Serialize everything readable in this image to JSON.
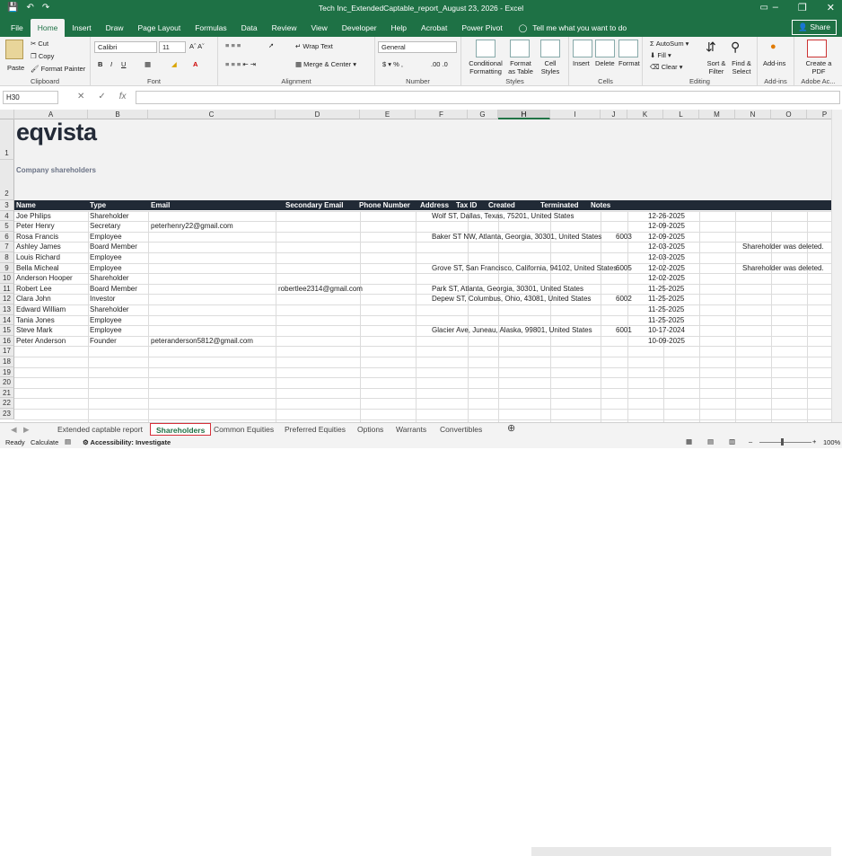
{
  "title_bar": {
    "title": "Tech Inc_ExtendedCaptable_report_August 23, 2026  -  Excel"
  },
  "ribbon_tabs": [
    "File",
    "Home",
    "Insert",
    "Draw",
    "Page Layout",
    "Formulas",
    "Data",
    "Review",
    "View",
    "Developer",
    "Help",
    "Acrobat",
    "Power Pivot"
  ],
  "tell_me": "Tell me what you want to do",
  "share_label": "Share",
  "ribbon": {
    "clipboard": {
      "paste": "Paste",
      "cut": "Cut",
      "copy": "Copy",
      "format_painter": "Format Painter",
      "label": "Clipboard"
    },
    "font": {
      "name": "Calibri",
      "size": "11",
      "label": "Font"
    },
    "alignment": {
      "wrap": "Wrap Text",
      "merge": "Merge & Center",
      "label": "Alignment"
    },
    "number": {
      "format": "General",
      "label": "Number"
    },
    "styles": {
      "conditional": "Conditional Formatting",
      "table": "Format as Table",
      "cell_styles": "Cell Styles",
      "label": "Styles"
    },
    "cells": {
      "insert": "Insert",
      "delete": "Delete",
      "format": "Format",
      "label": "Cells"
    },
    "editing": {
      "autosum": "AutoSum",
      "fill": "Fill",
      "clear": "Clear",
      "sort": "Sort & Filter",
      "find": "Find & Select",
      "label": "Editing"
    },
    "addins": {
      "addins": "Add-ins",
      "label": "Add-ins"
    },
    "adobe": {
      "create_pdf": "Create a PDF",
      "label": "Adobe Ac..."
    }
  },
  "formula_bar": {
    "name_box": "H30",
    "value": ""
  },
  "columns": [
    "A",
    "B",
    "C",
    "D",
    "E",
    "F",
    "G",
    "H",
    "I",
    "J",
    "K",
    "L",
    "M",
    "N",
    "O",
    "P"
  ],
  "rows": [
    "1",
    "2",
    "3",
    "4",
    "5",
    "6",
    "7",
    "8",
    "9",
    "10",
    "11",
    "12",
    "13",
    "14",
    "15",
    "16",
    "17",
    "18",
    "19",
    "20",
    "21",
    "22",
    "23"
  ],
  "sheet": {
    "logo": "eqvista",
    "subtitle": "Company shareholders",
    "headers": [
      "Name",
      "Type",
      "Email",
      "Secondary Email",
      "Phone Number",
      "Address",
      "Tax ID",
      "Created",
      "Terminated",
      "Notes"
    ],
    "data": [
      [
        "Joe Philips",
        "Shareholder",
        "",
        "",
        "",
        "Wolf ST, Dallas, Texas, 75201, United States",
        "",
        "12-26-2025",
        ""
      ],
      [
        "Peter Henry",
        "Secretary",
        "peterhenry22@gmail.com",
        "",
        "",
        "",
        "",
        "12-09-2025",
        ""
      ],
      [
        "Rosa Francis",
        "Employee",
        "",
        "",
        "",
        "Baker ST NW, Atlanta, Georgia, 30301, United States",
        "6003",
        "12-09-2025",
        ""
      ],
      [
        "Ashley James",
        "Board Member",
        "",
        "",
        "",
        "",
        "",
        "12-03-2025",
        "Shareholder was deleted."
      ],
      [
        "Louis Richard",
        "Employee",
        "",
        "",
        "",
        "",
        "",
        "12-03-2025",
        ""
      ],
      [
        "Bella Micheal",
        "Employee",
        "",
        "",
        "",
        "Grove ST, San Francisco, California, 94102, United States",
        "6005",
        "12-02-2025",
        "Shareholder was deleted."
      ],
      [
        "Anderson Hooper",
        "Shareholder",
        "",
        "",
        "",
        "",
        "",
        "12-02-2025",
        ""
      ],
      [
        "Robert Lee",
        "Board Member",
        "",
        "robertlee2314@gmail.com",
        "",
        "Park ST, Atlanta, Georgia, 30301, United States",
        "",
        "11-25-2025",
        ""
      ],
      [
        "Clara John",
        "Investor",
        "",
        "",
        "",
        "Depew ST, Columbus, Ohio, 43081, United States",
        "6002",
        "11-25-2025",
        ""
      ],
      [
        "Edward William",
        "Shareholder",
        "",
        "",
        "",
        "",
        "",
        "11-25-2025",
        ""
      ],
      [
        "Tania Jones",
        "Employee",
        "",
        "",
        "",
        "",
        "",
        "11-25-2025",
        ""
      ],
      [
        "Steve Mark",
        "Employee",
        "",
        "",
        "",
        "Glacier Ave, Juneau, Alaska, 99801, United States",
        "6001",
        "10-17-2024",
        ""
      ],
      [
        "Peter Anderson",
        "Founder",
        "peteranderson5812@gmail.com",
        "",
        "",
        "",
        "",
        "10-09-2025",
        ""
      ]
    ]
  },
  "sheet_tabs": [
    "Extended captable report",
    "Shareholders",
    "Common Equities",
    "Preferred Equities",
    "Options",
    "Warrants",
    "Convertibles"
  ],
  "active_sheet": "Shareholders",
  "status": {
    "ready": "Ready",
    "calculate": "Calculate",
    "accessibility": "Accessibility: Investigate",
    "zoom": "100%"
  }
}
